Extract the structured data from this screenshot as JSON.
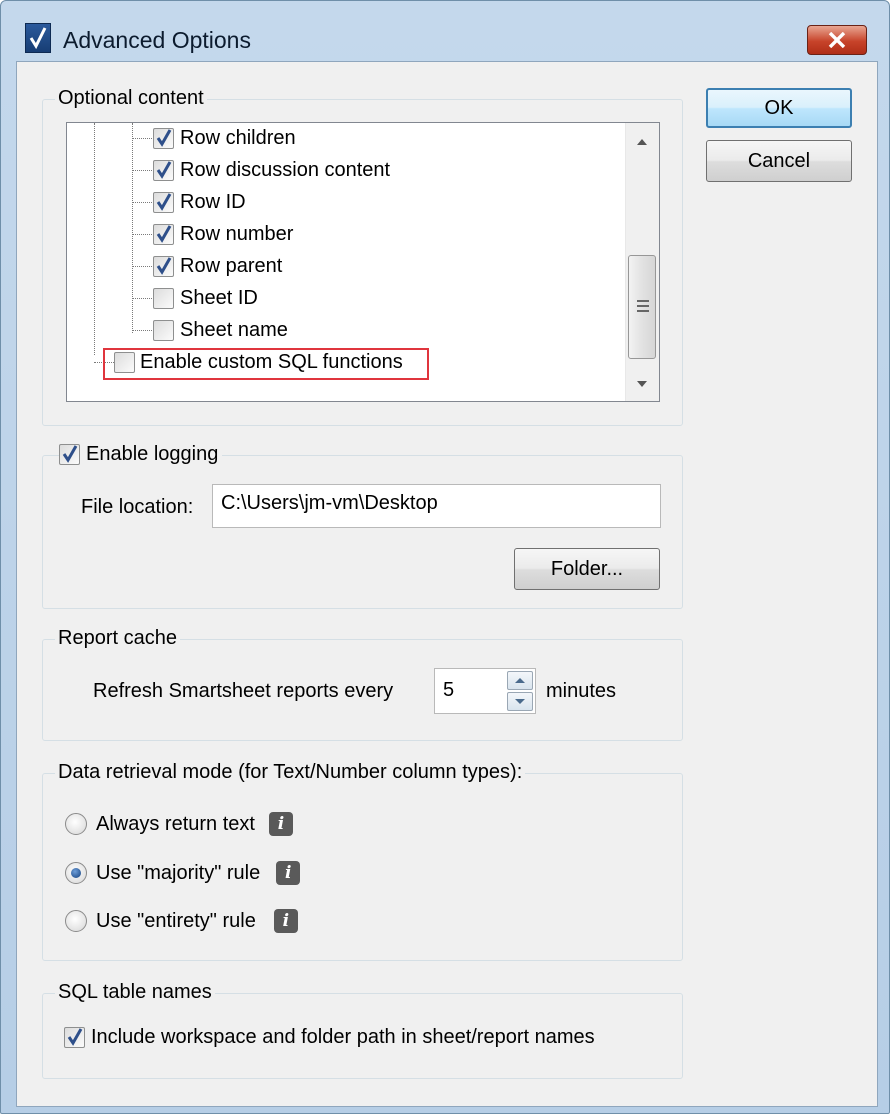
{
  "window": {
    "title": "Advanced Options"
  },
  "buttons": {
    "ok": "OK",
    "cancel": "Cancel",
    "folder": "Folder..."
  },
  "optional_content": {
    "label": "Optional content",
    "items": [
      {
        "label": "Row children",
        "checked": true
      },
      {
        "label": "Row discussion content",
        "checked": true
      },
      {
        "label": "Row ID",
        "checked": true
      },
      {
        "label": "Row number",
        "checked": true
      },
      {
        "label": "Row parent",
        "checked": true
      },
      {
        "label": "Sheet ID",
        "checked": false
      },
      {
        "label": "Sheet name",
        "checked": false
      }
    ],
    "custom_sql": {
      "label": "Enable custom SQL functions",
      "checked": false
    }
  },
  "logging": {
    "label": "Enable logging",
    "checked": true,
    "file_location_label": "File location:",
    "file_location_value": "C:\\Users\\jm-vm\\Desktop"
  },
  "report_cache": {
    "label": "Report cache",
    "prefix": "Refresh Smartsheet reports every",
    "value": "5",
    "suffix": "minutes"
  },
  "retrieval": {
    "label": "Data retrieval mode (for Text/Number column types):",
    "options": [
      {
        "label": "Always return text",
        "selected": false
      },
      {
        "label": "Use \"majority\" rule",
        "selected": true
      },
      {
        "label": "Use \"entirety\" rule",
        "selected": false
      }
    ],
    "info_icon": "i"
  },
  "sql_names": {
    "label": "SQL table names",
    "checkbox_label": "Include workspace and folder path in sheet/report names",
    "checked": true
  },
  "colors": {
    "highlight": "#e0353d",
    "titlebar": "#c4d8ec",
    "close": "#c7432a"
  }
}
